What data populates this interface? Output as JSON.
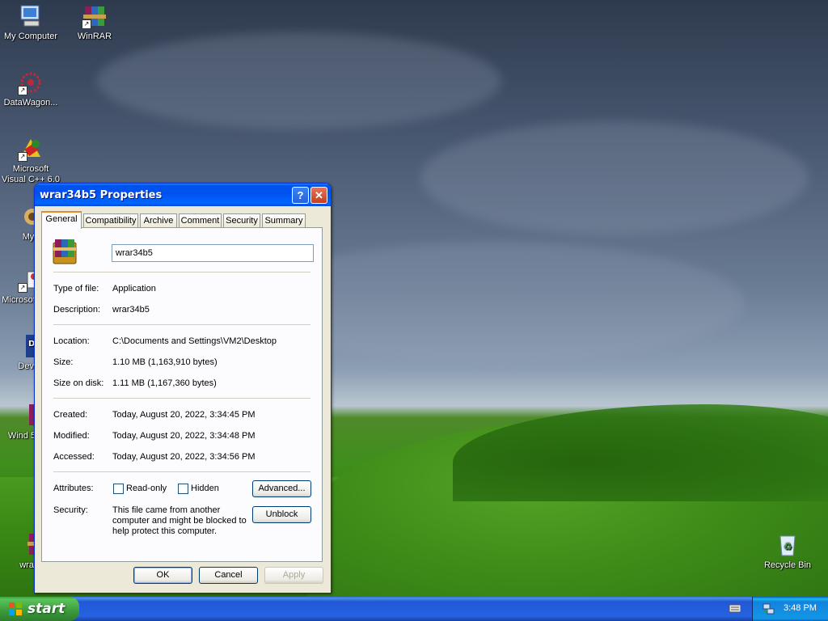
{
  "desktop": {
    "icons": [
      {
        "label": "My Computer"
      },
      {
        "label": "WinRAR"
      },
      {
        "label": "DataWagon..."
      },
      {
        "label": "Microsoft Visual C++ 6.0"
      },
      {
        "label": "Myp"
      },
      {
        "label": "Microsof Basic"
      },
      {
        "label": "Dev-C"
      },
      {
        "label": "Wind 5e7er"
      },
      {
        "label": "wrar3"
      },
      {
        "label": "Recycle Bin"
      }
    ]
  },
  "window": {
    "title": "wrar34b5 Properties",
    "tabs": [
      "General",
      "Compatibility",
      "Archive",
      "Comment",
      "Security",
      "Summary"
    ],
    "active_tab": "General",
    "name_value": "wrar34b5",
    "fields": {
      "type_label": "Type of file:",
      "type_value": "Application",
      "desc_label": "Description:",
      "desc_value": "wrar34b5",
      "location_label": "Location:",
      "location_value": "C:\\Documents and Settings\\VM2\\Desktop",
      "size_label": "Size:",
      "size_value": "1.10 MB (1,163,910 bytes)",
      "sizedisk_label": "Size on disk:",
      "sizedisk_value": "1.11 MB (1,167,360 bytes)",
      "created_label": "Created:",
      "created_value": "Today, August 20, 2022, 3:34:45 PM",
      "modified_label": "Modified:",
      "modified_value": "Today, August 20, 2022, 3:34:48 PM",
      "accessed_label": "Accessed:",
      "accessed_value": "Today, August 20, 2022, 3:34:56 PM",
      "attributes_label": "Attributes:",
      "readonly_label": "Read-only",
      "hidden_label": "Hidden",
      "advanced_label": "Advanced...",
      "security_label": "Security:",
      "security_text": "This file came from another computer and might be blocked to help protect this computer.",
      "unblock_label": "Unblock"
    },
    "buttons": {
      "ok": "OK",
      "cancel": "Cancel",
      "apply": "Apply"
    }
  },
  "taskbar": {
    "start_label": "start",
    "clock": "3:48 PM"
  }
}
